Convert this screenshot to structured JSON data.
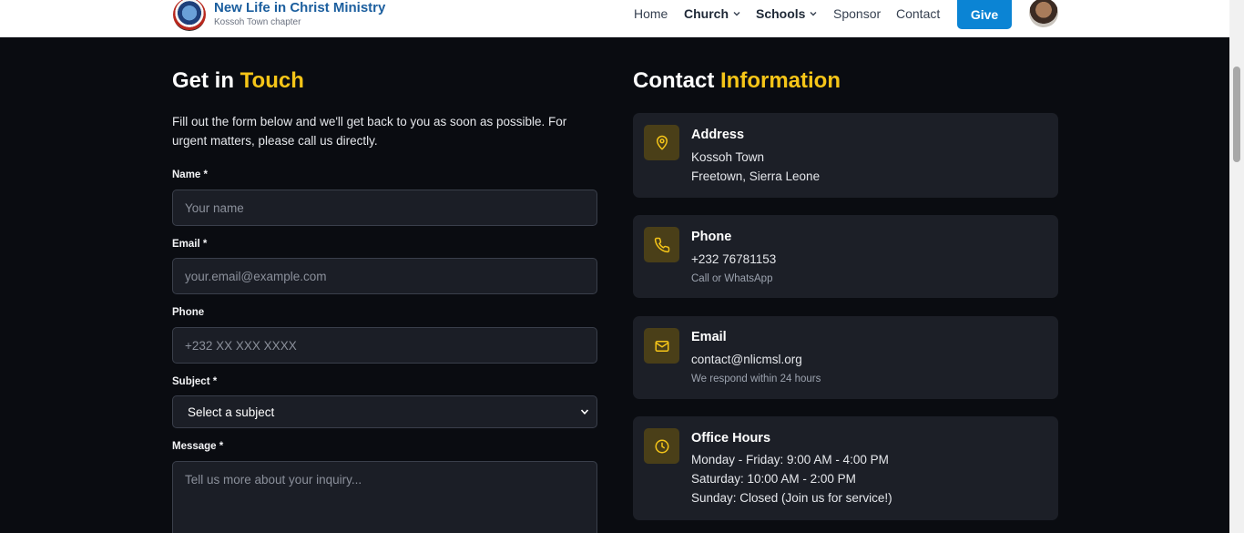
{
  "header": {
    "brand_title": "New Life in Christ Ministry",
    "brand_subtitle": "Kossoh Town chapter",
    "nav": {
      "home": "Home",
      "church": "Church",
      "schools": "Schools",
      "sponsor": "Sponsor",
      "contact": "Contact"
    },
    "give_label": "Give"
  },
  "form_section": {
    "title_part1": "Get in ",
    "title_part2": "Touch",
    "intro": "Fill out the form below and we'll get back to you as soon as possible. For urgent matters, please call us directly.",
    "name_label": "Name *",
    "name_placeholder": "Your name",
    "email_label": "Email *",
    "email_placeholder": "your.email@example.com",
    "phone_label": "Phone",
    "phone_placeholder": "+232 XX XXX XXXX",
    "subject_label": "Subject *",
    "subject_value": "Select a subject",
    "message_label": "Message *",
    "message_placeholder": "Tell us more about your inquiry..."
  },
  "contact_info": {
    "title_part1": "Contact ",
    "title_part2": "Information",
    "address": {
      "title": "Address",
      "line1": "Kossoh Town",
      "line2": "Freetown, Sierra Leone"
    },
    "phone": {
      "title": "Phone",
      "number": "+232 76781153",
      "note": "Call or WhatsApp"
    },
    "email": {
      "title": "Email",
      "address": "contact@nlicmsl.org",
      "note": "We respond within 24 hours"
    },
    "hours": {
      "title": "Office Hours",
      "weekday": "Monday - Friday: 9:00 AM - 4:00 PM",
      "saturday": "Saturday: 10:00 AM - 2:00 PM",
      "sunday": "Sunday: Closed (Join us for service!)"
    }
  },
  "colors": {
    "accent": "#f5c518",
    "brand_blue": "#1b5e9e",
    "give_button": "#0b84d4",
    "background": "#0a0c11"
  }
}
